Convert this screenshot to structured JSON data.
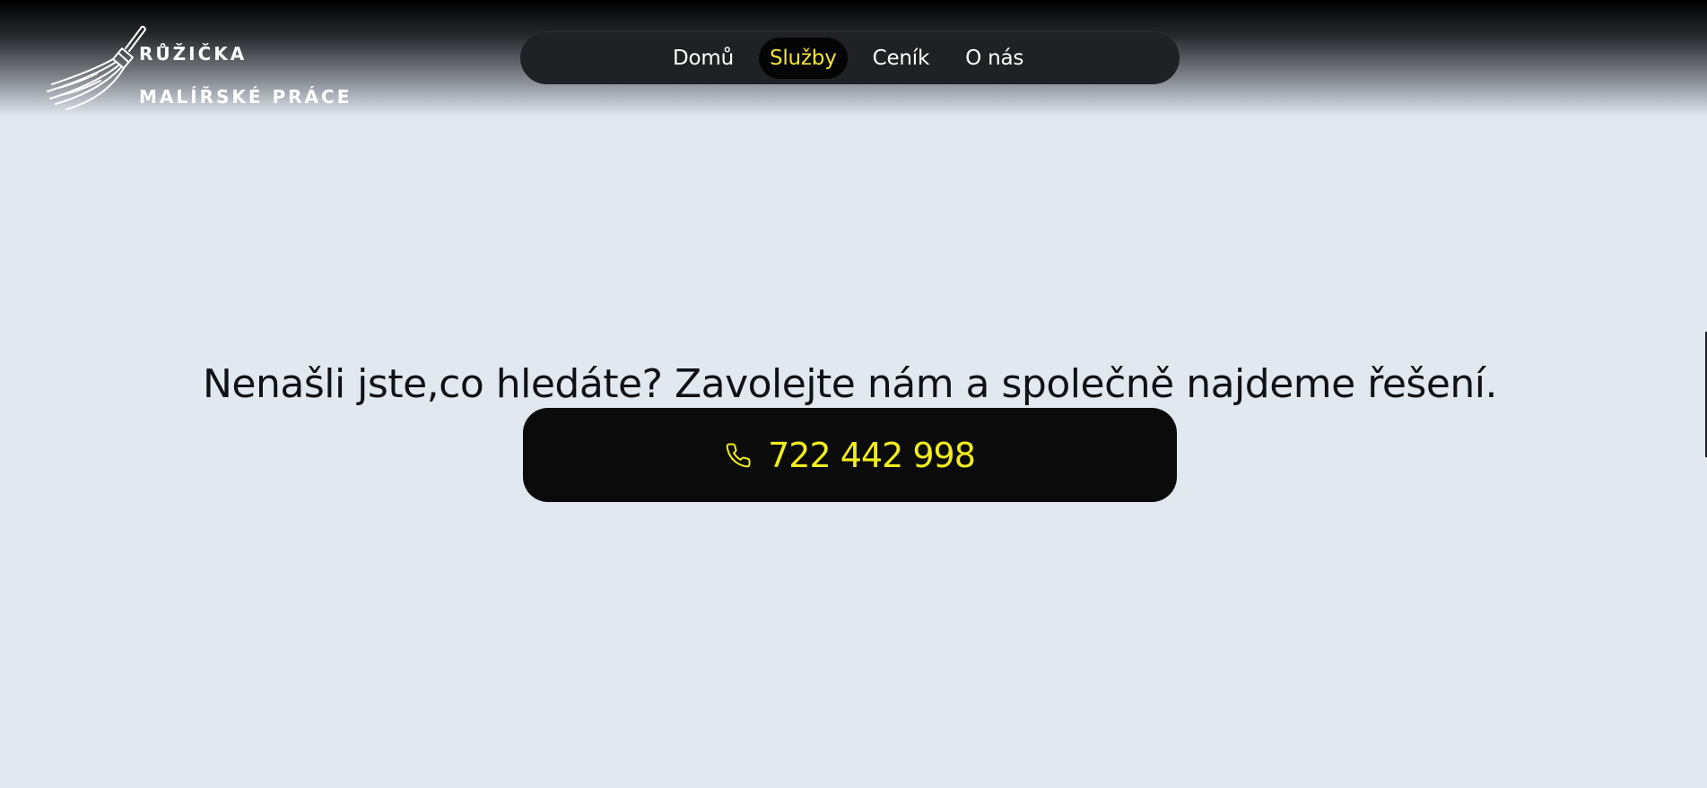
{
  "brand": {
    "name": "RŮŽIČKA",
    "tagline": "MALÍŘSKÉ PRÁCE",
    "logo_icon": "paintbrush-icon"
  },
  "nav": {
    "items": [
      {
        "label": "Domů",
        "active": false
      },
      {
        "label": "Služby",
        "active": true
      },
      {
        "label": "Ceník",
        "active": false
      },
      {
        "label": "O nás",
        "active": false
      }
    ]
  },
  "main": {
    "heading": "Nenašli jste,co hledáte? Zavolejte nám a společně najdeme řešení.",
    "call_button": {
      "icon": "phone-icon",
      "phone": "722 442 998"
    }
  },
  "colors": {
    "background": "#e1e8f0",
    "nav_bg": "#202124",
    "accent_yellow": "#f2ee1c",
    "button_bg": "#0b0b0c"
  }
}
